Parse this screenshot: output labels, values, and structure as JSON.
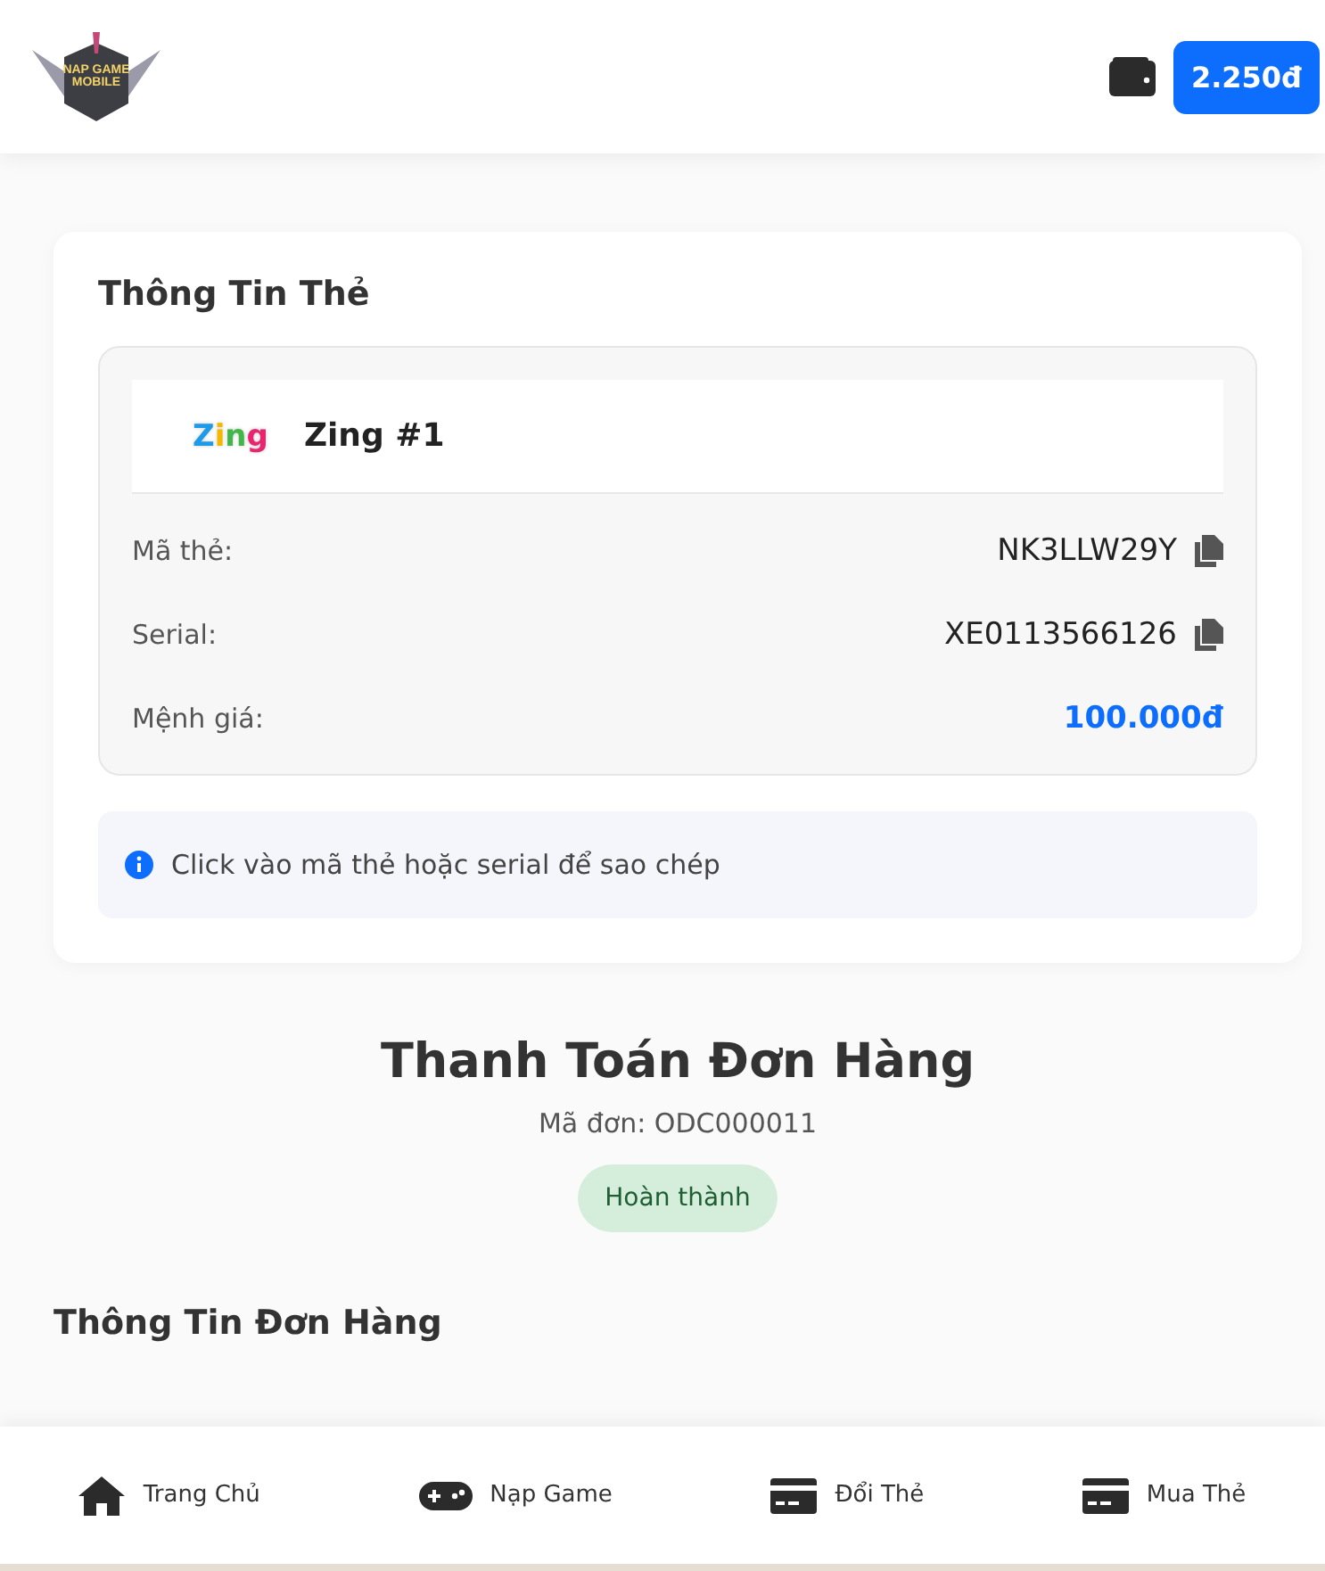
{
  "header": {
    "logo_text": [
      "NAP GAME",
      "MOBILE"
    ],
    "balance": "2.250đ"
  },
  "card_info": {
    "title": "Thông Tin Thẻ",
    "brand_logo": "Zing",
    "card_name": "Zing #1",
    "rows": [
      {
        "label": "Mã thẻ:",
        "value": "NK3LLW29Y",
        "kind": "copy"
      },
      {
        "label": "Serial:",
        "value": "XE0113566126",
        "kind": "copy"
      },
      {
        "label": "Mệnh giá:",
        "value": "100.000đ",
        "kind": "price"
      }
    ],
    "hint": "Click vào mã thẻ hoặc serial để sao chép"
  },
  "order": {
    "title": "Thanh Toán Đơn Hàng",
    "code": "Mã đơn: ODC000011",
    "status": "Hoàn thành"
  },
  "order_info_title": "Thông Tin Đơn Hàng",
  "bottom_nav": [
    {
      "label": "Trang Chủ",
      "kind": "home"
    },
    {
      "label": "Nạp Game",
      "kind": "game"
    },
    {
      "label": "Đổi Thẻ",
      "kind": "card"
    },
    {
      "label": "Mua Thẻ",
      "kind": "card"
    }
  ]
}
